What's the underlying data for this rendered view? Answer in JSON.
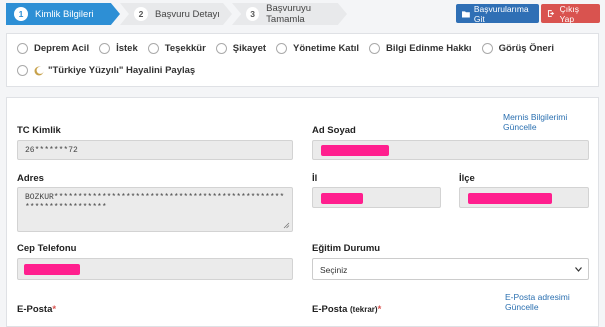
{
  "steps": [
    {
      "num": "1",
      "label": "Kimlik Bilgileri"
    },
    {
      "num": "2",
      "label": "Başvuru Detayı"
    },
    {
      "num": "3",
      "label": "Başvuruyu Tamamla"
    }
  ],
  "actions": {
    "applications": "Başvurularıma Git",
    "logout": "Çıkış Yap"
  },
  "types": [
    "Deprem Acil",
    "İstek",
    "Teşekkür",
    "Şikayet",
    "Yönetime Katıl",
    "Bilgi Edinme Hakkı",
    "Görüş Öneri"
  ],
  "special_type": "\"Türkiye Yüzyılı\" Hayalini Paylaş",
  "form": {
    "mernis_link": "Mernis Bilgilerimi Güncelle",
    "tc_label": "TC Kimlik",
    "tc_value": "26*******72",
    "name_label": "Ad Soyad",
    "address_label": "Adres",
    "address_line1": "BOZKUR*****************************************************************",
    "address_line2": "*****************",
    "city_label": "İl",
    "district_label": "İlçe",
    "phone_label": "Cep Telefonu",
    "education_label": "Eğitim Durumu",
    "education_value": "Seçiniz",
    "email_link": "E-Posta adresimi Güncelle",
    "email_label": "E-Posta",
    "email_confirm_label": "E-Posta",
    "email_confirm_small": "(tekrar)",
    "required_mark": "*"
  },
  "colors": {
    "primary": "#2d8fd5",
    "apps_button": "#2f6fb5",
    "logout_button": "#d9534f",
    "redaction": "#ff1f8e"
  }
}
